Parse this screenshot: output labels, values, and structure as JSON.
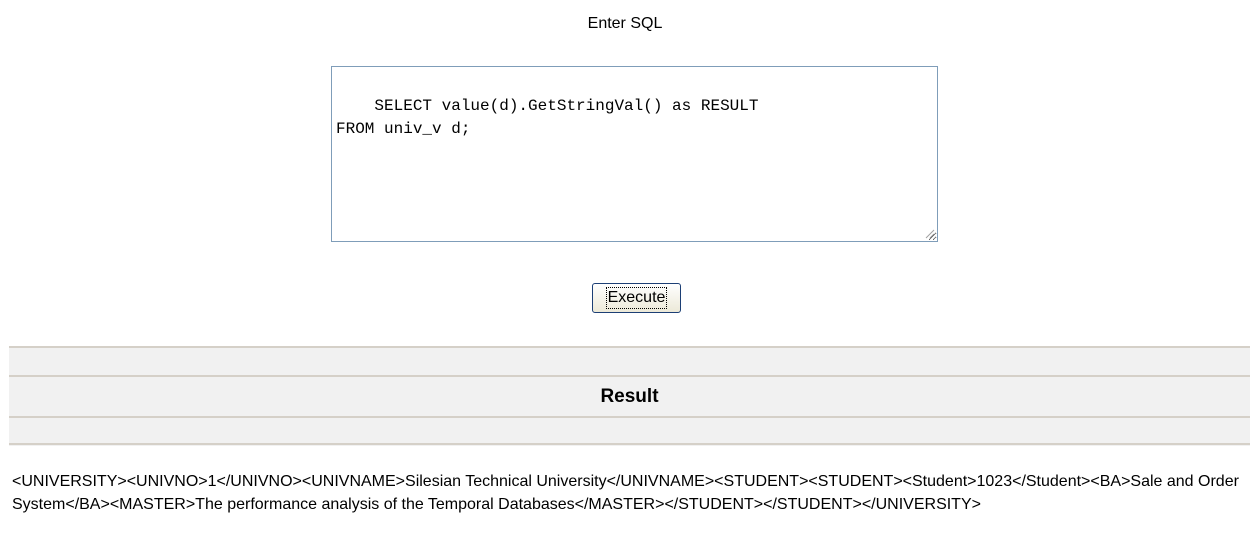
{
  "sql_form": {
    "label": "Enter SQL",
    "query": "SELECT value(d).GetStringVal() as RESULT\nFROM univ_v d;",
    "execute_label": "Execute"
  },
  "result": {
    "title": "Result",
    "output": "<UNIVERSITY><UNIVNO>1</UNIVNO><UNIVNAME>Silesian Technical University</UNIVNAME><STUDENT><STUDENT><Student>1023</Student><BA>Sale and Order System</BA><MASTER>The performance analysis of the Temporal Databases</MASTER></STUDENT></STUDENT></UNIVERSITY>"
  },
  "icons": {
    "resize": "resize-grip-icon"
  }
}
